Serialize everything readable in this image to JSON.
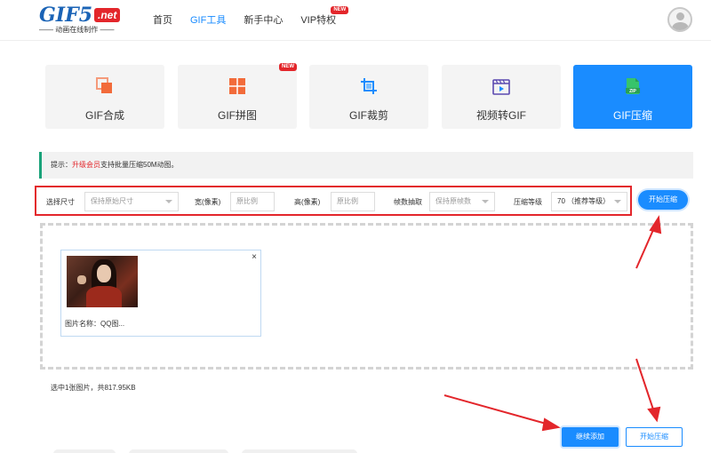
{
  "header": {
    "logo_main": "GIF5",
    "logo_net": ".net",
    "logo_sub": "—— 动画在线制作 ——",
    "nav": [
      {
        "label": "首页",
        "active": false
      },
      {
        "label": "GIF工具",
        "active": true
      },
      {
        "label": "新手中心",
        "active": false
      },
      {
        "label": "VIP特权",
        "active": false,
        "badge": "NEW"
      }
    ]
  },
  "tools": [
    {
      "label": "GIF合成",
      "icon": "gif-merge-icon",
      "active": false
    },
    {
      "label": "GIF拼图",
      "icon": "gif-collage-icon",
      "active": false,
      "badge": "NEW"
    },
    {
      "label": "GIF裁剪",
      "icon": "crop-icon",
      "active": false
    },
    {
      "label": "视频转GIF",
      "icon": "video-to-gif-icon",
      "active": false
    },
    {
      "label": "GIF压缩",
      "icon": "zip-icon",
      "active": true,
      "icon_text": "ZIP"
    }
  ],
  "tip": {
    "prefix": "提示：",
    "link": "升级会员",
    "suffix": "支持批量压缩50M动图。"
  },
  "options": {
    "size_label": "选择尺寸",
    "size_value": "保持原始尺寸",
    "width_label": "宽(像素)",
    "width_placeholder": "原比例",
    "height_label": "高(像素)",
    "height_placeholder": "原比例",
    "frames_label": "帧数抽取",
    "frames_value": "保持原帧数",
    "level_label": "压缩等级",
    "level_value": "70 （推荐等级）",
    "start_button": "开始压缩"
  },
  "files": [
    {
      "name_label": "图片名称：QQ图...",
      "close": "×"
    }
  ],
  "summary": "选中1张图片，共817.95KB",
  "buttons": {
    "continue_add": "继续添加",
    "start_compress": "开始压缩"
  },
  "colors": {
    "accent": "#1a8cff",
    "annotation_red": "#e3262b",
    "tip_border": "#1aa37a"
  }
}
